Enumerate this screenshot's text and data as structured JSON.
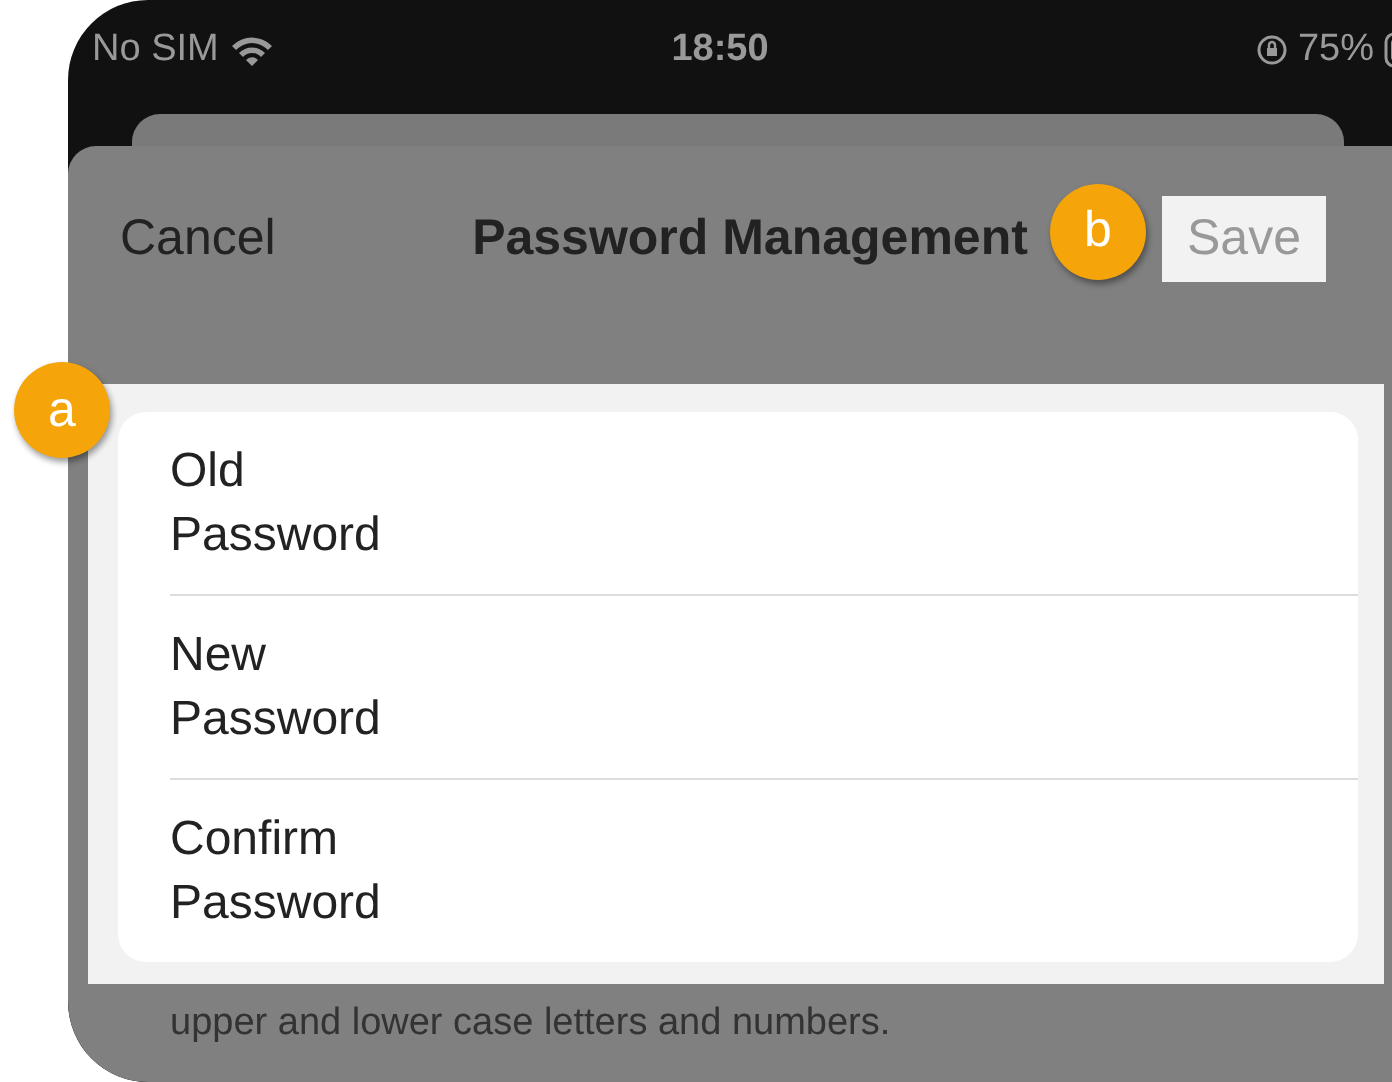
{
  "status_bar": {
    "carrier": "No SIM",
    "time": "18:50",
    "battery": "75%"
  },
  "header": {
    "cancel": "Cancel",
    "title": "Password Management",
    "save": "Save",
    "save_disabled": true
  },
  "fields": [
    {
      "label": "Old Password"
    },
    {
      "label": "New Password"
    },
    {
      "label": "Confirm Password"
    }
  ],
  "hint": "upper and lower case letters and numbers.",
  "callouts": [
    {
      "label": "a"
    },
    {
      "label": "b"
    }
  ]
}
